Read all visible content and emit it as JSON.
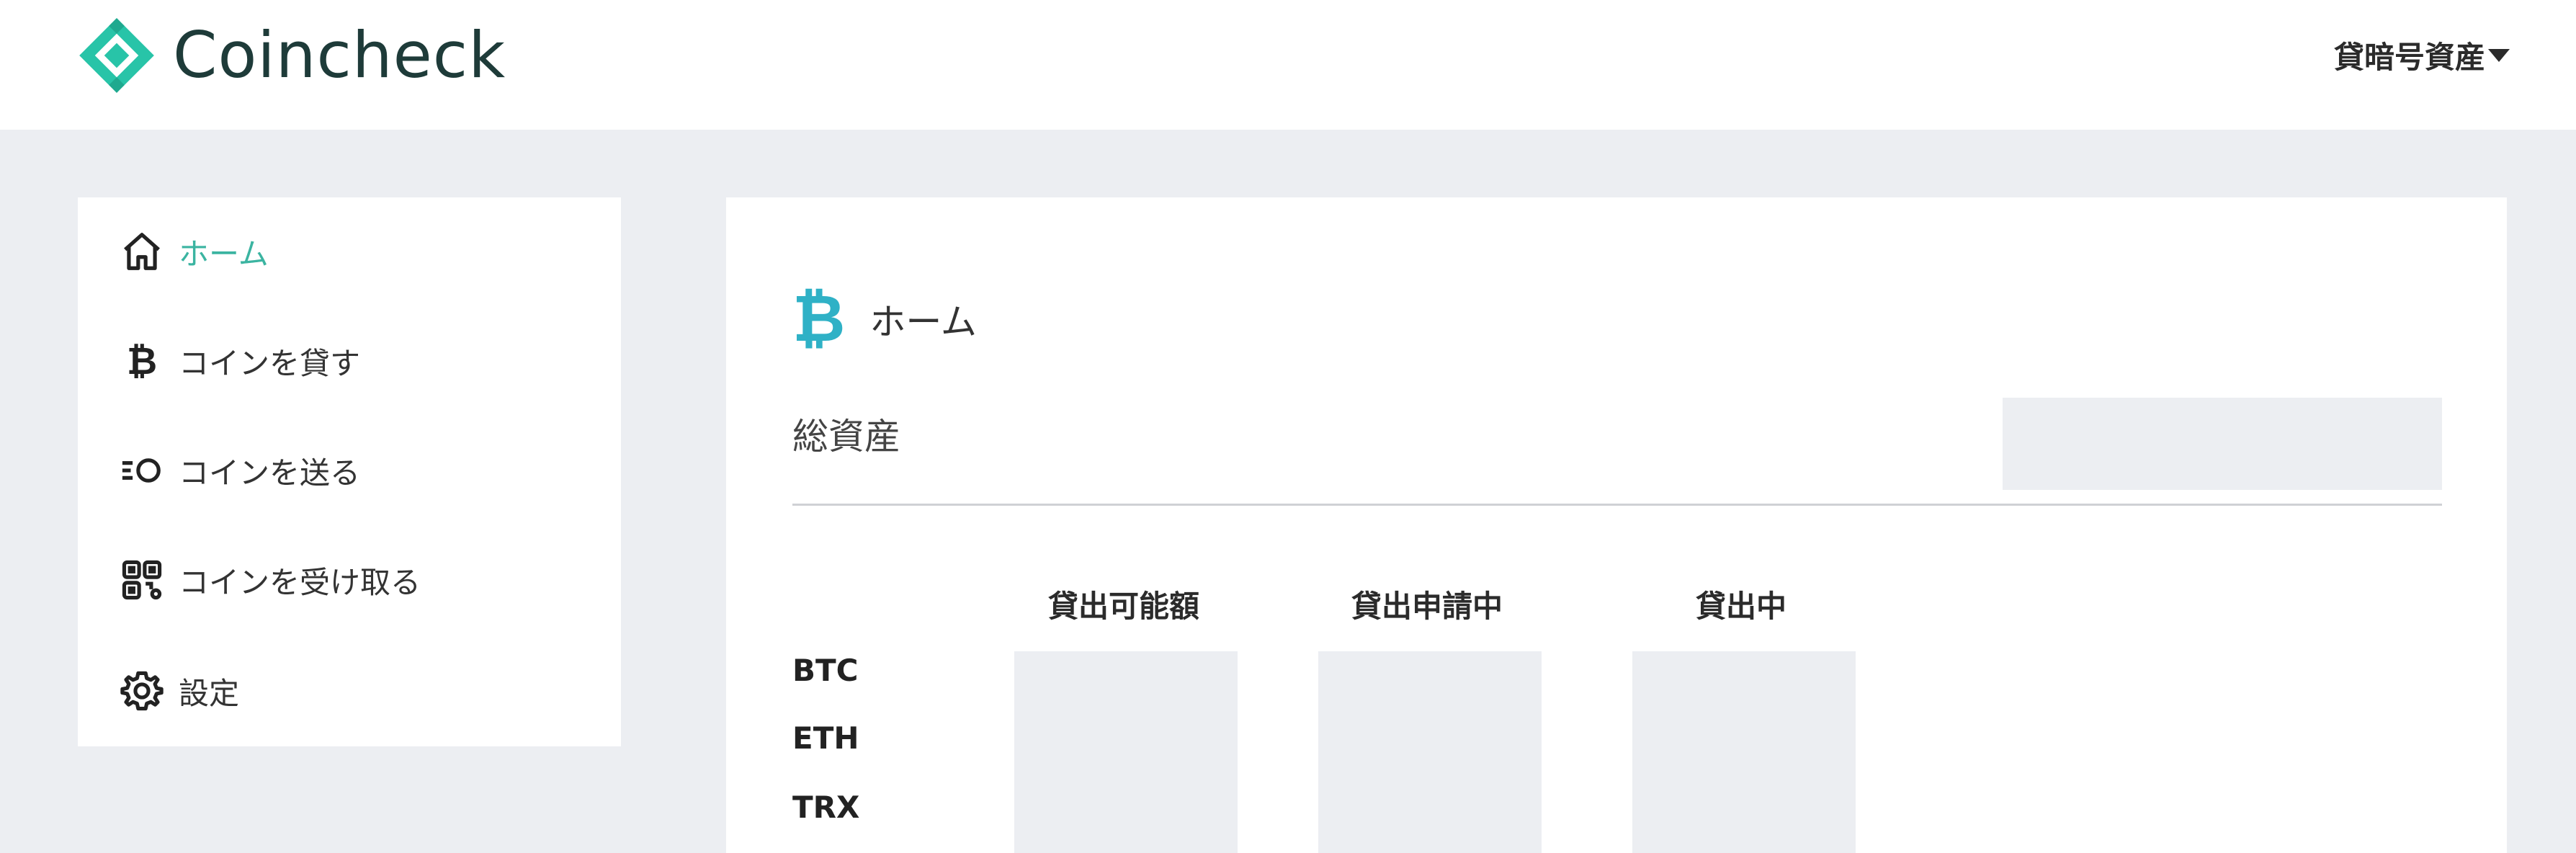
{
  "header": {
    "brand": "Coincheck",
    "logo_icon": "coincheck-logo-icon",
    "account_menu_label": "貸暗号資産",
    "brand_color": "#3bb4a1",
    "logo_color": "#28c4a8"
  },
  "sidebar": {
    "items": [
      {
        "label": "ホーム",
        "icon": "home-icon",
        "active": true
      },
      {
        "label": "コインを貸す",
        "icon": "bitcoin-icon",
        "active": false
      },
      {
        "label": "コインを送る",
        "icon": "send-icon",
        "active": false
      },
      {
        "label": "コインを受け取る",
        "icon": "qr-code-icon",
        "active": false
      },
      {
        "label": "設定",
        "icon": "gear-icon",
        "active": false
      }
    ]
  },
  "main": {
    "heading_icon": "bitcoin-icon",
    "heading_icon_glyph": "₿",
    "title": "ホーム",
    "total_assets_label": "総資産",
    "columns": [
      "貸出可能額",
      "貸出申請中",
      "貸出中"
    ],
    "coins": [
      "BTC",
      "ETH",
      "TRX"
    ],
    "accent_color": "#2fb1c6"
  }
}
